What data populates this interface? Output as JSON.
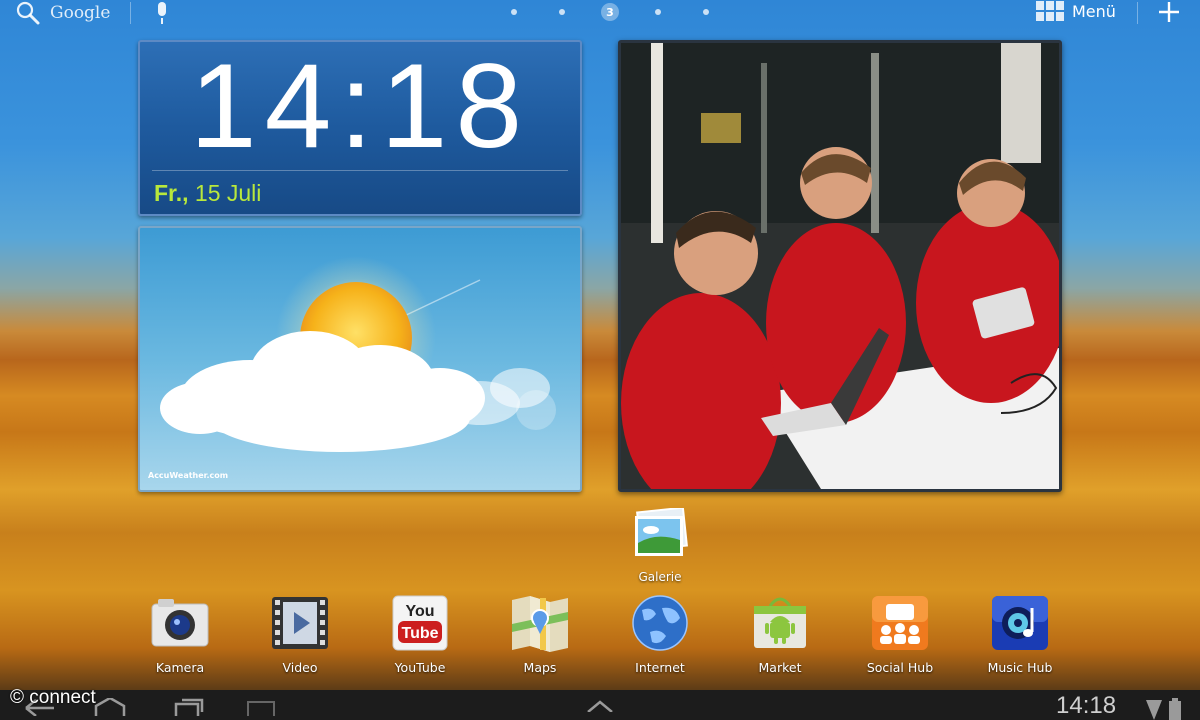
{
  "top_bar": {
    "search_label": "Google",
    "current_page": "3",
    "menu_label": "Menü"
  },
  "clock_widget": {
    "time": "14:18",
    "day": "Fr.,",
    "date": "15 Juli"
  },
  "weather_widget": {
    "provider": "AccuWeather.com",
    "condition_icon": "sun-behind-cloud"
  },
  "photo_widget": {
    "subject": "photo"
  },
  "shortcut": {
    "label": "Galerie"
  },
  "dock": {
    "apps": [
      {
        "label": "Kamera",
        "icon": "camera-icon"
      },
      {
        "label": "Video",
        "icon": "video-icon"
      },
      {
        "label": "YouTube",
        "icon": "youtube-icon"
      },
      {
        "label": "Maps",
        "icon": "maps-icon"
      },
      {
        "label": "Internet",
        "icon": "globe-icon"
      },
      {
        "label": "Market",
        "icon": "market-icon"
      },
      {
        "label": "Social Hub",
        "icon": "social-hub-icon"
      },
      {
        "label": "Music Hub",
        "icon": "music-hub-icon"
      }
    ]
  },
  "status_bar": {
    "time": "14:18"
  },
  "watermark": "© connect",
  "colors": {
    "clock_bg": "#1e5a9e",
    "date_green": "#b8e83c",
    "nav_bar": "#1c1c1c"
  }
}
